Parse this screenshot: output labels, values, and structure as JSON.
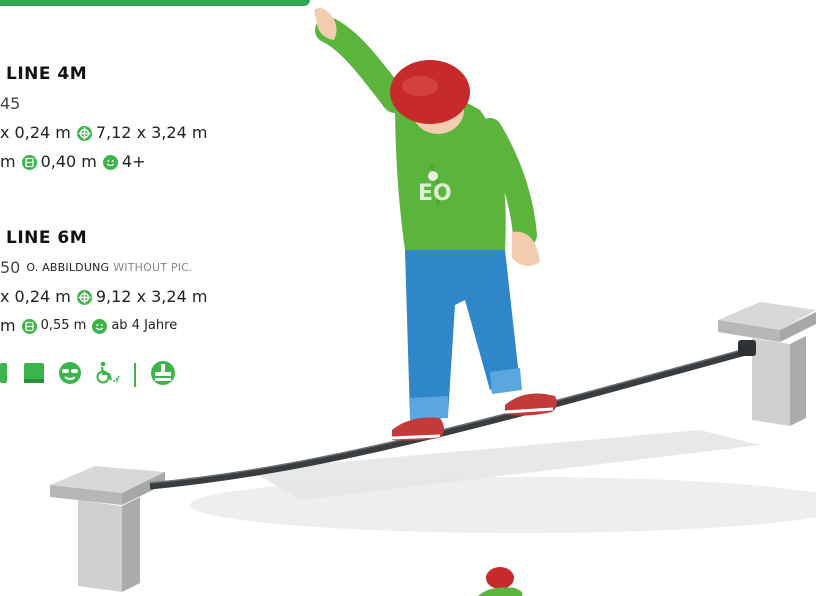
{
  "product_1": {
    "title": "LINE 4M",
    "code": "45",
    "dimensions": "x 0,24 m",
    "area": "7,12 x 3,24 m",
    "height_unit": "m",
    "fall_height": "0,40 m",
    "age": "4+"
  },
  "product_2": {
    "title": "LINE 6M",
    "code": "50",
    "code_note_de": "O. ABBILDUNG",
    "code_note_en": "WITHOUT PIC.",
    "dimensions": "x 0,24 m",
    "area": "9,12 x 3,24 m",
    "height_unit": "m",
    "fall_height": "0,55 m",
    "age": "ab 4 Jahre"
  },
  "icons": [
    "tree-icon",
    "book-icon",
    "sunglasses-face-icon",
    "wheelchair-icon",
    "ground-anchor-icon"
  ],
  "colors": {
    "accent_green": "#3bb54a",
    "text": "#222222",
    "shirt_green": "#5bb53c",
    "jeans_blue": "#2f86c8",
    "cap_red": "#c62a2a",
    "concrete": "#c9cbca"
  }
}
